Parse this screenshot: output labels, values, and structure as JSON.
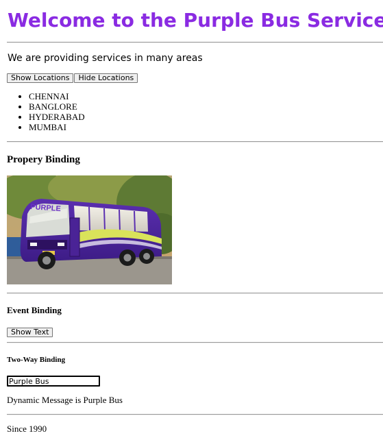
{
  "page": {
    "title": "Welcome to the Purple Bus Services",
    "intro": "We are providing services in many areas",
    "accent_color": "#8a2be2"
  },
  "locations": {
    "show_label": "Show Locations",
    "hide_label": "Hide Locations",
    "items": [
      "CHENNAI",
      "BANGLORE",
      "HYDERABAD",
      "MUMBAI"
    ]
  },
  "property_binding": {
    "heading": "Propery Binding",
    "image_text": "PURPLE"
  },
  "event_binding": {
    "heading": "Event Binding",
    "button_label": "Show Text"
  },
  "two_way_binding": {
    "heading": "Two-Way Binding",
    "input_value": "Purple Bus",
    "message": "Dynamic Message is Purple Bus"
  },
  "footer": {
    "since": "Since 1990"
  }
}
